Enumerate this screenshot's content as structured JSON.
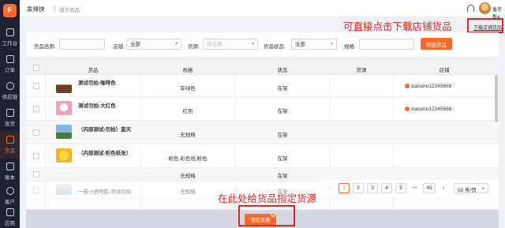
{
  "app": {
    "brand": "发得快",
    "subbrand": "铺货商品",
    "user": "番老板a"
  },
  "colors": {
    "accent": "#ff6a2a",
    "annotation": "#e82020",
    "sidebar": "#1f2230"
  },
  "sidebar": {
    "logo": "F",
    "items": [
      {
        "label": "工作台",
        "icon": "workbench-icon"
      },
      {
        "label": "订单",
        "icon": "order-icon"
      },
      {
        "label": "供应链",
        "icon": "supply-chain-icon"
      },
      {
        "label": "发货",
        "icon": "truck-icon"
      },
      {
        "label": "货品",
        "icon": "goods-icon",
        "active": true
      },
      {
        "label": "账本",
        "icon": "ledger-icon"
      },
      {
        "label": "客户",
        "icon": "customer-icon"
      },
      {
        "label": "应用",
        "icon": "apps-icon"
      }
    ]
  },
  "filter": {
    "goods_name_label": "货品名称:",
    "goods_name_value": "",
    "shop_label": "店铺:",
    "shop_value": "全部",
    "source_label": "货源:",
    "source_placeholder": "请选择",
    "status_label": "货品状态:",
    "status_value": "全部",
    "spec_label": "规格:",
    "spec_value": "",
    "filter_button": "筛选货品",
    "download_link": "下载店铺货品"
  },
  "table": {
    "headers": [
      "货品",
      "规格",
      "状态",
      "货源",
      "店铺"
    ],
    "rows": [
      {
        "name": "测试勿拍-咖啡色",
        "spec": "军绿色",
        "status": "在架",
        "source": "",
        "shop": "xiaoshu12345666"
      },
      {
        "name": "测试勿拍-大红色",
        "spec": "红色",
        "status": "在架",
        "source": "",
        "shop": "xiaoshu12345666"
      },
      {
        "name": "（内部测试-勿拍）蓝天",
        "spec": "无规格",
        "status": "在架",
        "source": "",
        "shop": ""
      },
      {
        "name": "（内部测试-彩色纸张）",
        "spec": "粉色;彩色纸;粉色",
        "status": "在架",
        "source": "",
        "shop": ""
      },
      {
        "name": "",
        "spec": "无规格",
        "status": "在架",
        "source": "",
        "shop": ""
      },
      {
        "name": "一巷小透明胶-测试勿拍",
        "spec": "无规格",
        "status": "在架",
        "source": "",
        "shop": ""
      }
    ]
  },
  "pagination": {
    "prev": "‹",
    "pages": [
      "1",
      "2",
      "3",
      "4",
      "5"
    ],
    "ellipsis": "•••",
    "last": "49",
    "next": "›",
    "page_size": "50 条/页",
    "current": "1"
  },
  "bottom": {
    "assign_button": "指定货源",
    "badge": "2"
  },
  "annotations": {
    "download_hint": "可直接点击下载店铺货品",
    "assign_hint": "在此处给货品指定货源"
  }
}
